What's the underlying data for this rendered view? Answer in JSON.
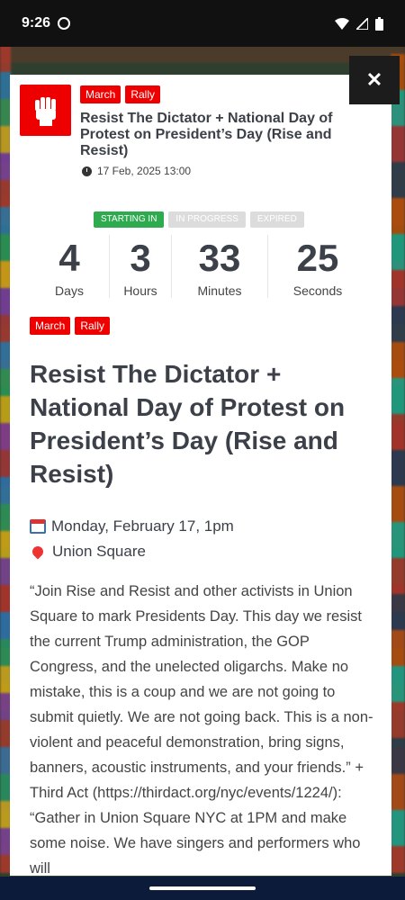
{
  "status_bar": {
    "time": "9:26"
  },
  "modal": {
    "close_label": "✕",
    "tags": [
      "March",
      "Rally"
    ],
    "header_title": "Resist The Dictator + National Day of Protest on President’s Day (Rise and Resist)",
    "header_date": "17 Feb, 2025 13:00",
    "status_pills": [
      "STARTING IN",
      "IN PROGRESS",
      "EXPIRED"
    ],
    "countdown": [
      {
        "value": "4",
        "label": "Days"
      },
      {
        "value": "3",
        "label": "Hours"
      },
      {
        "value": "33",
        "label": "Minutes"
      },
      {
        "value": "25",
        "label": "Seconds"
      }
    ],
    "title": "Resist The Dictator + National Day of Protest on President’s Day (Rise and Resist)",
    "date_line": "Monday, February 17, 1pm",
    "location": "Union Square",
    "description": "“Join Rise and Resist and other activists in Union Square to mark Presidents Day. This day we resist the current Trump administration, the GOP Congress, and the unelected oligarchs. Make no mistake, this is a coup and we are not going to submit quietly. We are not going back. This is a non-violent and peaceful demonstration, bring signs, banners, acoustic instruments, and your friends.” + Third Act (https://thirdact.org/nyc/events/1224/): “Gather in Union Square NYC at 1PM and make some noise. We have singers and performers who will"
  },
  "colors": {
    "accent_red": "#ee0000",
    "status_green": "#2eaa4f",
    "text_dark": "#3c4048"
  }
}
